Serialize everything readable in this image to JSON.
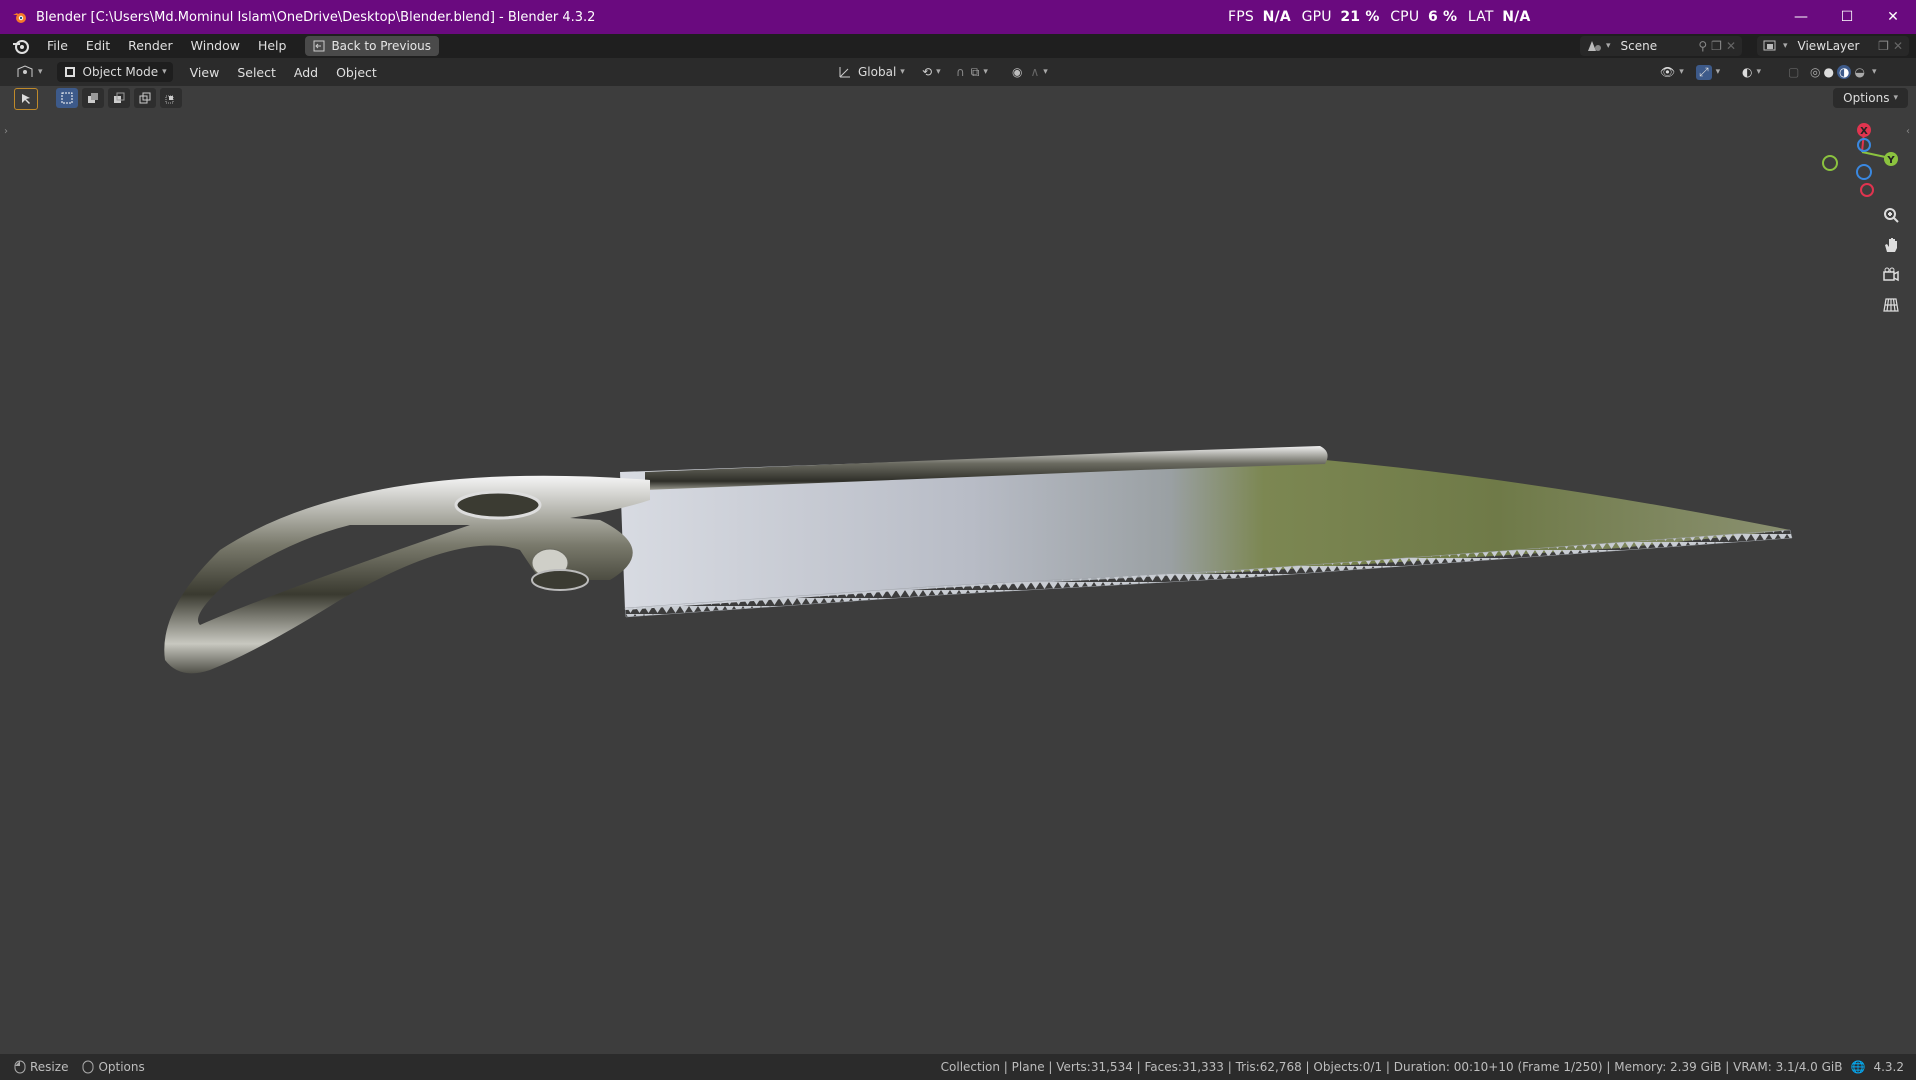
{
  "window": {
    "title": "Blender [C:\\Users\\Md.Mominul Islam\\OneDrive\\Desktop\\Blender.blend] - Blender 4.3.2",
    "stats": {
      "fps_label": "FPS",
      "fps_value": "N/A",
      "gpu_label": "GPU",
      "gpu_value": "21 %",
      "cpu_label": "CPU",
      "cpu_value": "6 %",
      "lat_label": "LAT",
      "lat_value": "N/A"
    },
    "controls": {
      "minimize": "—",
      "maximize": "☐",
      "close": "✕"
    }
  },
  "menubar": {
    "items": [
      "File",
      "Edit",
      "Render",
      "Window",
      "Help"
    ],
    "back_button": "Back to Previous",
    "scene": "Scene",
    "view_layer": "ViewLayer"
  },
  "viewport_header": {
    "mode": "Object Mode",
    "menus": [
      "View",
      "Select",
      "Add",
      "Object"
    ],
    "transform_orientation": "Global",
    "options": "Options"
  },
  "gizmo": {
    "x": "X",
    "y": "Y",
    "z": "Z"
  },
  "statusbar": {
    "left": [
      {
        "label": "Resize",
        "icon": "mouse-left-icon"
      },
      {
        "label": "Options",
        "icon": "mouse-right-icon"
      }
    ],
    "info": "Collection | Plane | Verts:31,534 | Faces:31,333 | Tris:62,768 | Objects:0/1 | Duration: 00:10+10 (Frame 1/250) | Memory: 2.39 GiB | VRAM: 3.1/4.0 GiB",
    "version": "4.3.2"
  },
  "colors": {
    "titlebar": "#6a0a7f",
    "viewport_bg": "#3d3d3d",
    "header_bg": "#2b2b2b",
    "axis_x": "#e0344f",
    "axis_y": "#8bc33f",
    "axis_z": "#3a88e0"
  }
}
